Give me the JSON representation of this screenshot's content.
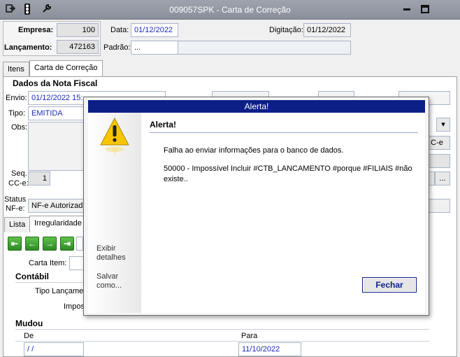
{
  "window": {
    "title": "009057SPK - Carta de Correção"
  },
  "header": {
    "empresa_label": "Empresa:",
    "empresa_value": "100",
    "lancamento_label": "Lançamento:",
    "lancamento_value": "472163",
    "data_label": "Data:",
    "data_value": "01/12/2022",
    "padrao_label": "Padrão:",
    "padrao_value": "...",
    "digitacao_label": "Digitação:",
    "digitacao_value": "01/12/2022"
  },
  "tabs": [
    "Itens",
    "Carta de Correção"
  ],
  "nf": {
    "section_title": "Dados da Nota Fiscal",
    "envio_label": "Envio:",
    "envio_value": "01/12/2022 15:",
    "tipo_label": "Tipo:",
    "tipo_value": "EMITIDA",
    "obs_label": "Obs:",
    "seq_label_1": "Seq.",
    "seq_label_2": "CC-e:",
    "seq_value": "1",
    "status_label_1": "Status",
    "status_label_2": "NF-e:",
    "status_value": "NF-e Autorizada",
    "cce_button": "C-e",
    "more_button": "..."
  },
  "subtabs": [
    "Lista",
    "Irregularidade"
  ],
  "nav_buttons": [
    "first",
    "previous",
    "next",
    "last"
  ],
  "carta": {
    "carta_item_label": "Carta Item:",
    "contabil_title": "Contábil",
    "tipo_lancamento_label": "Tipo Lançamen",
    "impostos_label": "Impos",
    "mudou_title": "Mudou",
    "de_header": "De",
    "para_header": "Para",
    "de_value": " /  /",
    "para_value": "11/10/2022"
  },
  "dialog": {
    "title": "Alerta!",
    "heading": "Alerta!",
    "message_1": "Falha ao enviar informações para o banco de dados.",
    "message_2": "50000 - Impossível Incluir #CTB_LANCAMENTO #porque #FILIAIS #não existe..",
    "exibir_detalhes": "Exibir detalhes",
    "salvar_como": "Salvar como...",
    "fechar_button": "Fechar"
  }
}
